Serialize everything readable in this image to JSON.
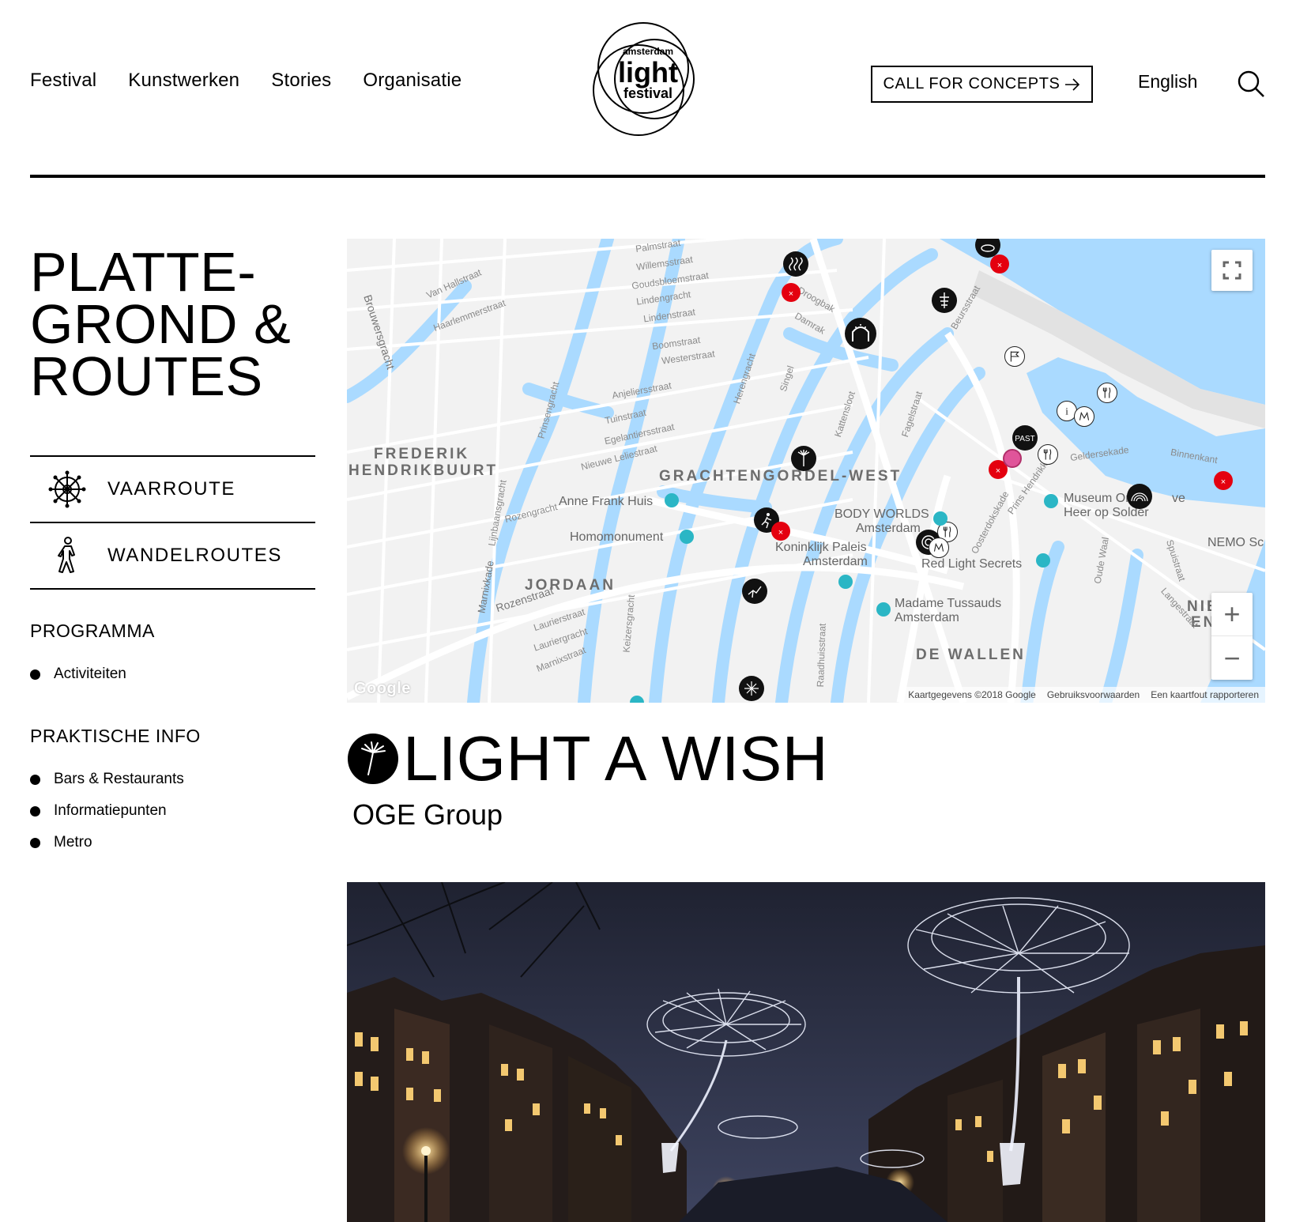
{
  "header": {
    "nav": [
      "Festival",
      "Kunstwerken",
      "Stories",
      "Organisatie"
    ],
    "logo": {
      "line1": "amsterdam",
      "line2": "light",
      "line3": "festival"
    },
    "cta_label": "CALL FOR CONCEPTS",
    "language": "English"
  },
  "sidebar": {
    "title_lines": [
      "PLATTE-",
      "GROND &",
      "ROUTES"
    ],
    "routes": [
      {
        "label": "VAARROUTE",
        "icon": "ship-wheel-icon"
      },
      {
        "label": "WANDELROUTES",
        "icon": "walking-person-icon"
      }
    ],
    "programma": {
      "title": "PROGRAMMA",
      "items": [
        "Activiteiten"
      ]
    },
    "praktische_info": {
      "title": "PRAKTISCHE INFO",
      "items": [
        "Bars & Restaurants",
        "Informatiepunten",
        "Metro"
      ]
    }
  },
  "map": {
    "areas": [
      "FREDERIK",
      "HENDRIKBUURT",
      "GRACHTENGORDEL-WEST",
      "JORDAAN",
      "DE WALLEN",
      "NIE",
      "EN"
    ],
    "pois": [
      "Anne Frank Huis",
      "Homomonument",
      "BODY WORLDS",
      "Amsterdam",
      "Koninklijk Paleis",
      "Amsterdam",
      "Red Light Secrets",
      "Madame Tussauds",
      "Amsterdam",
      "Museum Ons",
      "ve",
      "Heer op Solder",
      "NEMO Sc"
    ],
    "streets": [
      "Palmstraat",
      "Willemsstraat",
      "Goudsbloemstraat",
      "Lindengracht",
      "Lindenstraat",
      "Boomstraat",
      "Westerstraat",
      "Anjeliersstraat",
      "Tuinstraat",
      "Egelantiersstraat",
      "Nieuwe Leliestraat",
      "Rozengracht",
      "Rozenstraat",
      "Laurierstraat",
      "Lauriergracht",
      "Marnixstraat",
      "Marnixkade",
      "Lijnbaansgracht",
      "Prinsengracht",
      "Keizersgracht",
      "Herengracht",
      "Singel",
      "Kattensloot",
      "Fagelstraat",
      "Van Hallstraat",
      "Haarlemmerstraat",
      "Brouwersgracht",
      "Droogbak",
      "Damrak",
      "Beursstraat",
      "Prins Hendrikkade",
      "Oosterdokskade",
      "Geldersekade",
      "Binnenkant",
      "Oude Waal",
      "Spuistraat",
      "Langestraat",
      "Raadhuisstraat"
    ],
    "google": "Google",
    "attribution": [
      "Kaartgegevens ©2018 Google",
      "Gebruiksvoorwaarden",
      "Een kaartfout rapporteren"
    ],
    "controls": {
      "fullscreen": "fullscreen-icon",
      "zoom_in": "+",
      "zoom_out": "−"
    }
  },
  "artwork": {
    "title": "LIGHT A WISH",
    "artist": "OGE Group",
    "icon": "dandelion-icon"
  },
  "colors": {
    "water": "#aadaff",
    "marker_red": "#e4000f",
    "poi_teal": "#2bb6c5",
    "marker_pink": "#e0559a"
  }
}
